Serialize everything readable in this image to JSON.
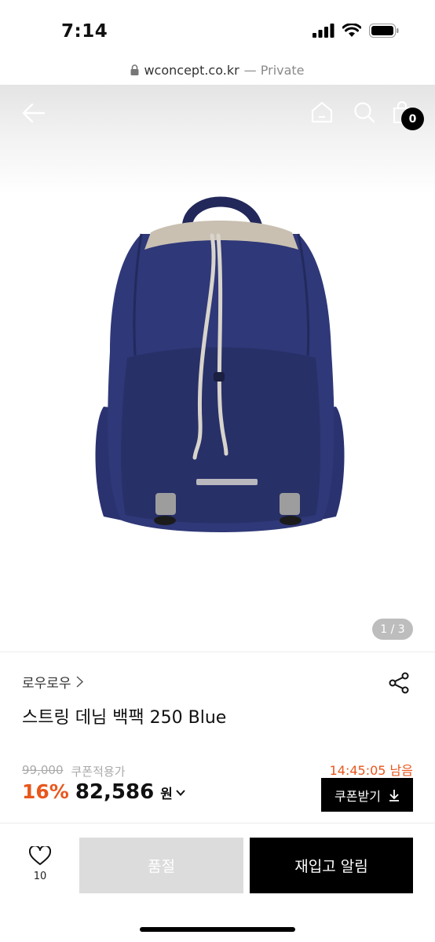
{
  "status_bar": {
    "time": "7:14"
  },
  "url_bar": {
    "domain": "wconcept.co.kr",
    "mode": "— Private"
  },
  "header": {
    "cart_count": "0"
  },
  "gallery": {
    "indicator": "1 / 3"
  },
  "product": {
    "brand": "로우로우",
    "name": "스트링 데님 백팩 250 Blue",
    "original_price": "99,000",
    "coupon_note": "쿠폰적용가",
    "timer": "14:45:05 남음",
    "discount": "16%",
    "price": "82,586",
    "currency": "원",
    "coupon_button": "쿠폰받기"
  },
  "actions": {
    "like_count": "10",
    "soldout_label": "품절",
    "restock_label": "재입고 알림"
  },
  "colors": {
    "accent": "#e8571d",
    "primary": "#000000",
    "disabled": "#dcdcdc"
  },
  "icons": [
    "back-arrow-icon",
    "home-icon",
    "search-icon",
    "cart-icon",
    "share-icon",
    "heart-icon",
    "download-icon",
    "chevron-down-icon",
    "chevron-right-icon",
    "lock-icon"
  ]
}
